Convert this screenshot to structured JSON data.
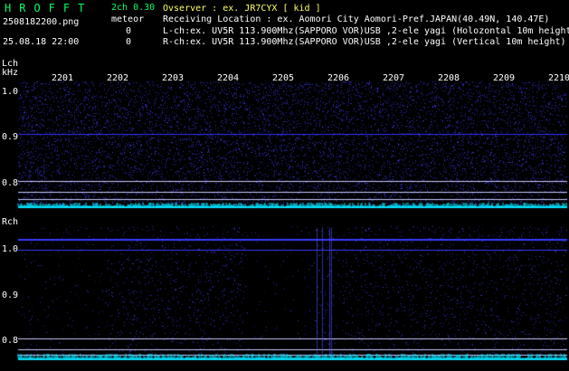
{
  "header": {
    "logo": "HROFFT",
    "filename": "2508182200.png",
    "datetime": "25.08.18 22:00",
    "version": "2ch 0.30",
    "meteor_label": "meteor",
    "meteor_counts": [
      "0",
      "0"
    ],
    "observer": "Ovserver          : ex. JR7CYX [ kid ]",
    "location": "Receiving Location : ex. Aomori City Aomori-Pref.JAPAN(40.49N, 140.47E)",
    "lch_info": "L-ch:ex. UV5R 113.900Mhz(SAPPORO VOR)USB ,2-ele yagi (Holozontal 10m height)",
    "rch_info": "R-ch:ex. UV5R 113.900Mhz(SAPPORO VOR)USB ,2-ele yagi (Vertical 10m height)"
  },
  "axis": {
    "lch_label": "Lch",
    "khz_label": "kHz",
    "rch_label": "Rch",
    "time_ticks": [
      "2201",
      "2202",
      "2203",
      "2204",
      "2205",
      "2206",
      "2207",
      "2208",
      "2209",
      "2210"
    ],
    "lch_freq_labels": [
      "1.0",
      "0.9",
      "0.8"
    ],
    "rch_freq_labels": [
      "1.0",
      "0.9",
      "0.8"
    ]
  },
  "colors": {
    "background": "#000000",
    "noise": "#1a1aa0",
    "signal": "#4040ff",
    "trace": "#00e5ff",
    "gridline": "#c8c8ff",
    "logo": "#00ff66",
    "title": "#ffff66"
  }
}
